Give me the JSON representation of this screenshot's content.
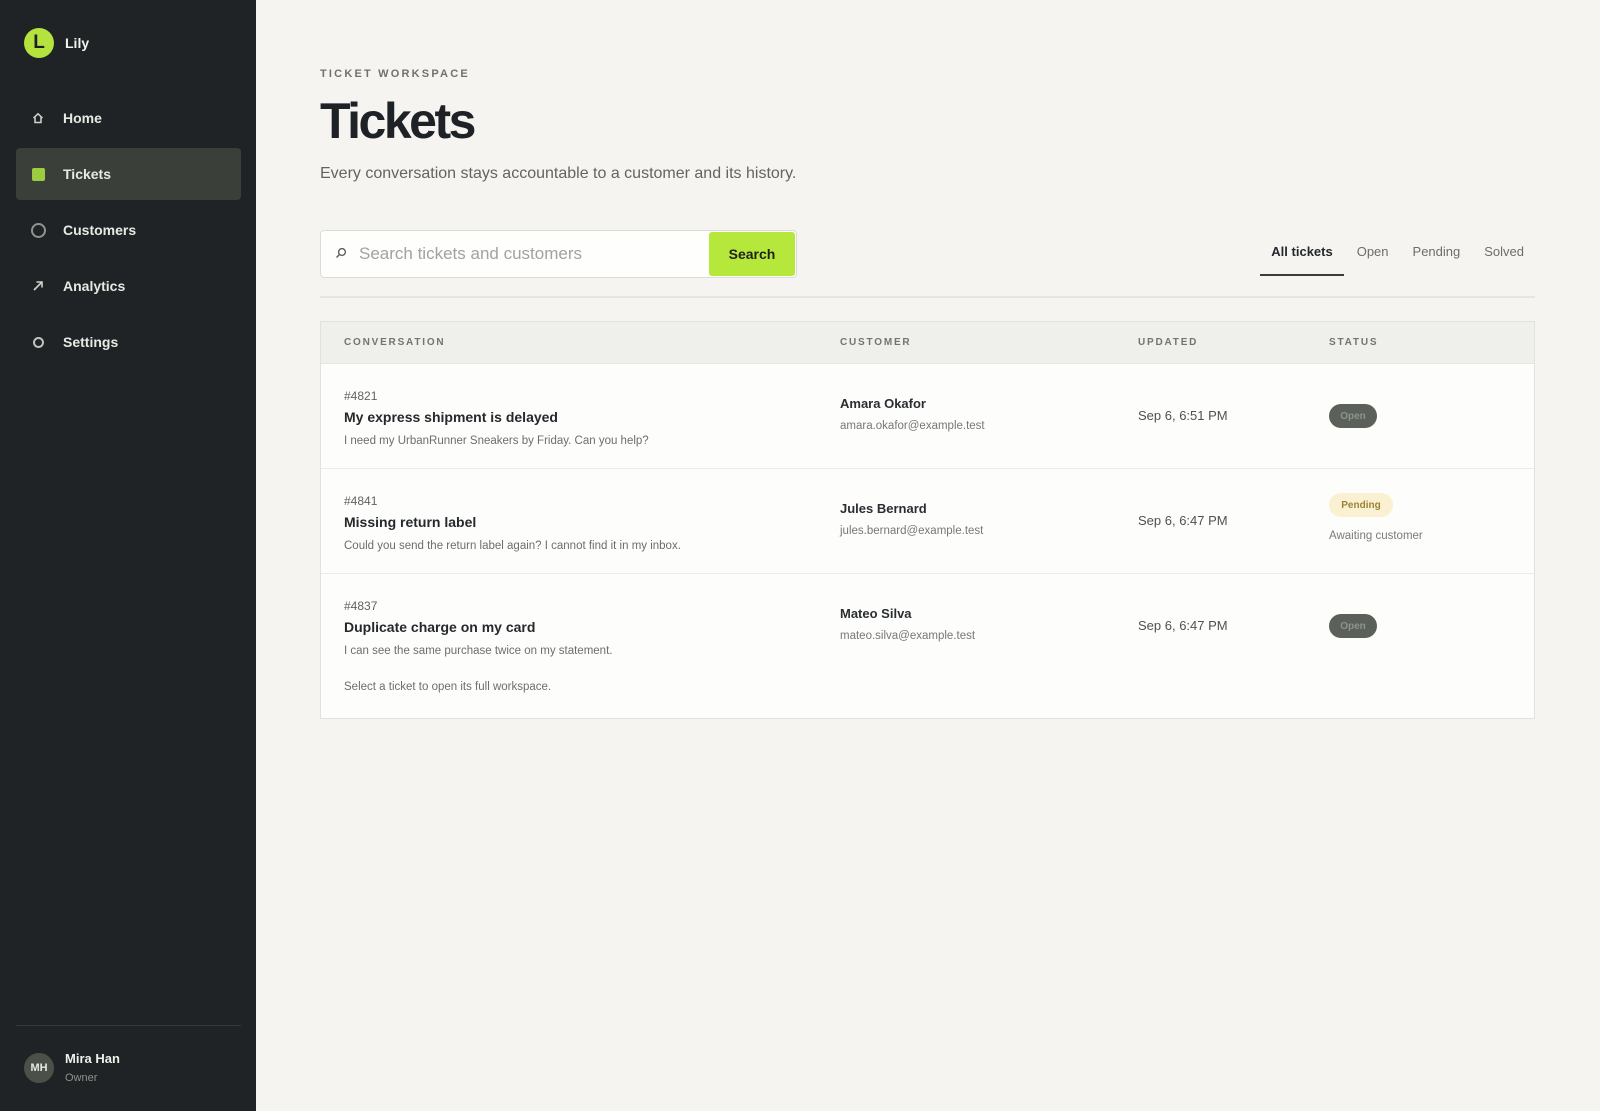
{
  "app": {
    "name": "Lily",
    "logo_letter": "L",
    "accent_color": "#b6e83c"
  },
  "sidebar": {
    "items": [
      {
        "label": "Home",
        "icon": "home-icon",
        "active": false
      },
      {
        "label": "Tickets",
        "icon": "tickets-icon",
        "active": true
      },
      {
        "label": "Customers",
        "icon": "customers-icon",
        "active": false
      },
      {
        "label": "Analytics",
        "icon": "analytics-icon",
        "active": false
      },
      {
        "label": "Settings",
        "icon": "settings-icon",
        "active": false
      }
    ]
  },
  "user": {
    "initials": "MH",
    "name": "Mira Han",
    "role": "Owner"
  },
  "header": {
    "eyebrow": "TICKET WORKSPACE",
    "title": "Tickets",
    "subtitle": "Every conversation stays accountable to a customer and its history."
  },
  "search": {
    "placeholder": "Search tickets and customers",
    "value": "",
    "button_label": "Search",
    "icon": "search-icon"
  },
  "tabs": [
    {
      "label": "All tickets",
      "active": true
    },
    {
      "label": "Open",
      "active": false
    },
    {
      "label": "Pending",
      "active": false
    },
    {
      "label": "Solved",
      "active": false
    }
  ],
  "table": {
    "columns": [
      "CONVERSATION",
      "CUSTOMER",
      "UPDATED",
      "STATUS"
    ],
    "rows": [
      {
        "id": "#4821",
        "subject": "My express shipment is delayed",
        "preview": "I need my UrbanRunner Sneakers by Friday. Can you help?",
        "customer_name": "Amara Okafor",
        "customer_email": "amara.okafor@example.test",
        "updated": "Sep 6, 6:51 PM",
        "status": "Open",
        "status_note": ""
      },
      {
        "id": "#4841",
        "subject": "Missing return label",
        "preview": "Could you send the return label again? I cannot find it in my inbox.",
        "customer_name": "Jules Bernard",
        "customer_email": "jules.bernard@example.test",
        "updated": "Sep 6, 6:47 PM",
        "status": "Pending",
        "status_note": "Awaiting customer"
      },
      {
        "id": "#4837",
        "subject": "Duplicate charge on my card",
        "preview": "I can see the same purchase twice on my statement.",
        "customer_name": "Mateo Silva",
        "customer_email": "mateo.silva@example.test",
        "updated": "Sep 6, 6:47 PM",
        "status": "Open",
        "status_note": ""
      }
    ],
    "footer_note": "Select a ticket to open its full workspace."
  }
}
